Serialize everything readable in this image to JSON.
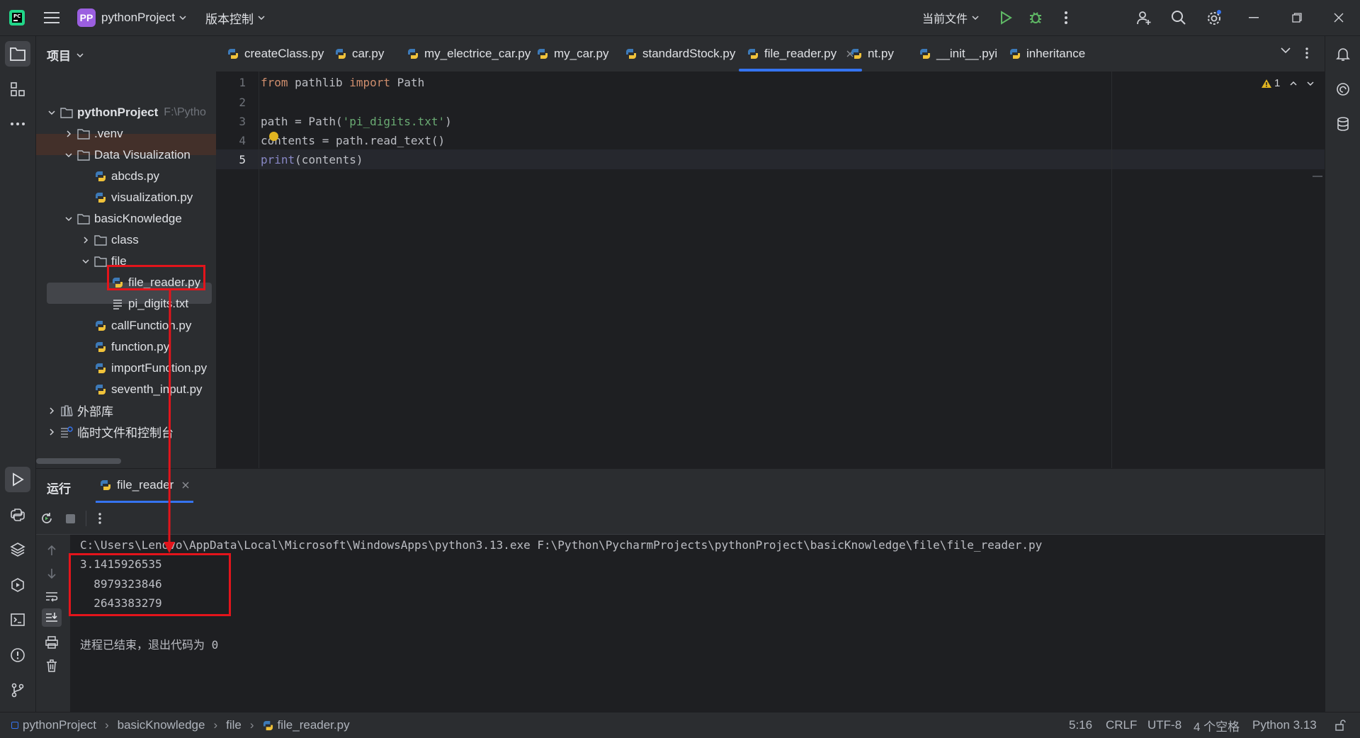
{
  "titlebar": {
    "project_badge": "PP",
    "project_name": "pythonProject",
    "vcs_label": "版本控制",
    "run_config": "当前文件"
  },
  "project_panel": {
    "title": "项目",
    "tree": [
      {
        "label": "pythonProject",
        "extra": "F:\\Pytho",
        "kind": "folder",
        "bold": true
      },
      {
        "label": ".venv",
        "kind": "folder"
      },
      {
        "label": "Data Visualization",
        "kind": "folder"
      },
      {
        "label": "abcds.py",
        "kind": "python"
      },
      {
        "label": "visualization.py",
        "kind": "python"
      },
      {
        "label": "basicKnowledge",
        "kind": "folder"
      },
      {
        "label": "class",
        "kind": "folder"
      },
      {
        "label": "file",
        "kind": "folder"
      },
      {
        "label": "file_reader.py",
        "kind": "python"
      },
      {
        "label": "pi_digits.txt",
        "kind": "text"
      },
      {
        "label": "callFunction.py",
        "kind": "python"
      },
      {
        "label": "function.py",
        "kind": "python"
      },
      {
        "label": "importFunction.py",
        "kind": "python"
      },
      {
        "label": "seventh_input.py",
        "kind": "python"
      },
      {
        "label": "外部库",
        "kind": "library"
      },
      {
        "label": "临时文件和控制台",
        "kind": "scratch"
      }
    ]
  },
  "editor": {
    "tabs": [
      {
        "label": "createClass.py"
      },
      {
        "label": "car.py"
      },
      {
        "label": "my_electrice_car.py"
      },
      {
        "label": "my_car.py"
      },
      {
        "label": "standardStock.py"
      },
      {
        "label": "file_reader.py",
        "active": true
      },
      {
        "label": "nt.py"
      },
      {
        "label": "__init__.pyi"
      },
      {
        "label": "inheritance"
      }
    ],
    "warning_count": "1",
    "line_numbers": [
      "1",
      "2",
      "3",
      "4",
      "5"
    ],
    "code": {
      "l1_kw1": "from",
      "l1_mod": " pathlib ",
      "l1_kw2": "import",
      "l1_name": " Path",
      "l3_a": "path = Path(",
      "l3_str": "'pi_digits.txt'",
      "l3_b": ")",
      "l4": "contents = path.read_text()",
      "l5_fn": "print",
      "l5_rest": "(contents)"
    }
  },
  "run_panel": {
    "title": "运行",
    "tab_label": "file_reader",
    "command": "C:\\Users\\Lenovo\\AppData\\Local\\Microsoft\\WindowsApps\\python3.13.exe F:\\Python\\PycharmProjects\\pythonProject\\basicKnowledge\\file\\file_reader.py",
    "output": [
      "3.1415926535",
      "  8979323846",
      "  2643383279"
    ],
    "exit_message": "进程已结束，退出代码为 0"
  },
  "statusbar": {
    "breadcrumb": [
      "pythonProject",
      "basicKnowledge",
      "file",
      "file_reader.py"
    ],
    "position": "5:16",
    "line_sep": "CRLF",
    "encoding": "UTF-8",
    "indent": "4 个空格",
    "interpreter": "Python 3.13"
  },
  "colors": {
    "accent": "#3574f0",
    "annotation_red": "#e3141b",
    "keyword": "#cf8e6d",
    "string": "#6aab73"
  }
}
